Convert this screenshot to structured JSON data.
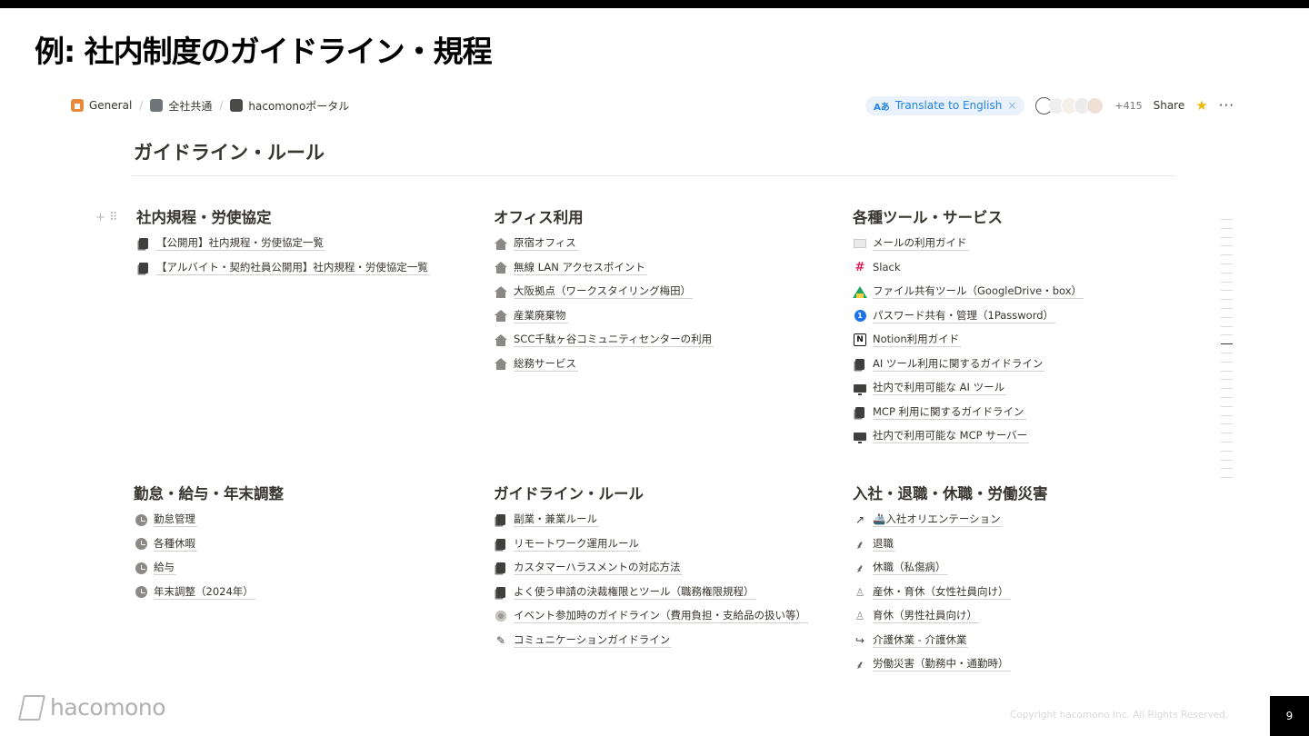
{
  "slide": {
    "title": "例: 社内制度のガイドライン・規程",
    "page_number": "9",
    "copyright": "Copyright hacomono Inc. All Rights Reserved.",
    "logo_text": "hacomono"
  },
  "breadcrumb": [
    {
      "label": "General",
      "icon": "house-icon"
    },
    {
      "label": "全社共通",
      "icon": "building-icon"
    },
    {
      "label": "hacomonoポータル",
      "icon": "page-icon"
    }
  ],
  "header": {
    "translate_label": "Translate to English",
    "translate_prefix": "Aあ",
    "translate_close": "×",
    "avatar_extra": "+415",
    "share_label": "Share",
    "favorite": "★",
    "more": "···"
  },
  "page": {
    "title": "ガイドライン・ルール",
    "drag_handle": "+ ⠿"
  },
  "sections": [
    {
      "heading": "社内規程・労使協定",
      "links": [
        {
          "icon": "page-link-icon",
          "text": "【公開用】社内規程・労使協定一覧"
        },
        {
          "icon": "page-link-icon",
          "text": "【アルバイト・契約社員公開用】社内規程・労使協定一覧"
        }
      ]
    },
    {
      "heading": "オフィス利用",
      "links": [
        {
          "icon": "house-icon",
          "text": "原宿オフィス"
        },
        {
          "icon": "house-icon",
          "text": "無線 LAN アクセスポイント"
        },
        {
          "icon": "house-icon",
          "text": "大阪拠点（ワークスタイリング梅田）"
        },
        {
          "icon": "house-icon",
          "text": "産業廃棄物"
        },
        {
          "icon": "house-icon",
          "text": "SCC千駄ヶ谷コミュニティセンターの利用"
        },
        {
          "icon": "house-icon",
          "text": "総務サービス"
        }
      ]
    },
    {
      "heading": "各種ツール・サービス",
      "links": [
        {
          "icon": "mail-icon",
          "text": "メールの利用ガイド"
        },
        {
          "icon": "slack-icon",
          "text": "Slack"
        },
        {
          "icon": "google-drive-icon",
          "text": "ファイル共有ツール（GoogleDrive・box）"
        },
        {
          "icon": "1password-icon",
          "text": "パスワード共有・管理（1Password）"
        },
        {
          "icon": "notion-icon",
          "text": "Notion利用ガイド"
        },
        {
          "icon": "page-icon",
          "text": "AI ツール利用に関するガイドライン"
        },
        {
          "icon": "monitor-icon",
          "text": "社内で利用可能な AI ツール"
        },
        {
          "icon": "page-icon",
          "text": "MCP 利用に関するガイドライン"
        },
        {
          "icon": "monitor-icon",
          "text": "社内で利用可能な MCP サーバー"
        }
      ]
    },
    {
      "heading": "勤怠・給与・年末調整",
      "links": [
        {
          "icon": "clock-icon",
          "text": "勤怠管理"
        },
        {
          "icon": "clock-icon",
          "text": "各種休暇"
        },
        {
          "icon": "clock-icon",
          "text": "給与"
        },
        {
          "icon": "clock-icon",
          "text": "年末調整（2024年）"
        }
      ]
    },
    {
      "heading": "ガイドライン・ルール",
      "links": [
        {
          "icon": "page-icon",
          "text": "副業・兼業ルール"
        },
        {
          "icon": "page-icon",
          "text": "リモートワーク運用ルール"
        },
        {
          "icon": "page-icon",
          "text": "カスタマーハラスメントの対応方法"
        },
        {
          "icon": "page-icon",
          "text": "よく使う申請の決裁権限とツール（職務権限規程）"
        },
        {
          "icon": "flower-icon",
          "text": "イベント参加時のガイドライン（費用負担・支給品の扱い等）"
        },
        {
          "icon": "note-icon",
          "text": "コミュニケーションガイドライン"
        }
      ]
    },
    {
      "heading": "入社・退職・休職・労働災害",
      "links": [
        {
          "icon": "ship-icon",
          "text": "🚢入社オリエンテーション"
        },
        {
          "icon": "plant-icon",
          "text": "退職"
        },
        {
          "icon": "plant-icon",
          "text": "休職（私傷病）"
        },
        {
          "icon": "person-icon",
          "text": "産休・育休（女性社員向け）"
        },
        {
          "icon": "person-icon",
          "text": "育休（男性社員向け）"
        },
        {
          "icon": "arrow-icon",
          "text": "介護休業 - 介護休業"
        },
        {
          "icon": "plant-icon",
          "text": "労働災害（勤務中・通勤時）"
        }
      ]
    }
  ]
}
